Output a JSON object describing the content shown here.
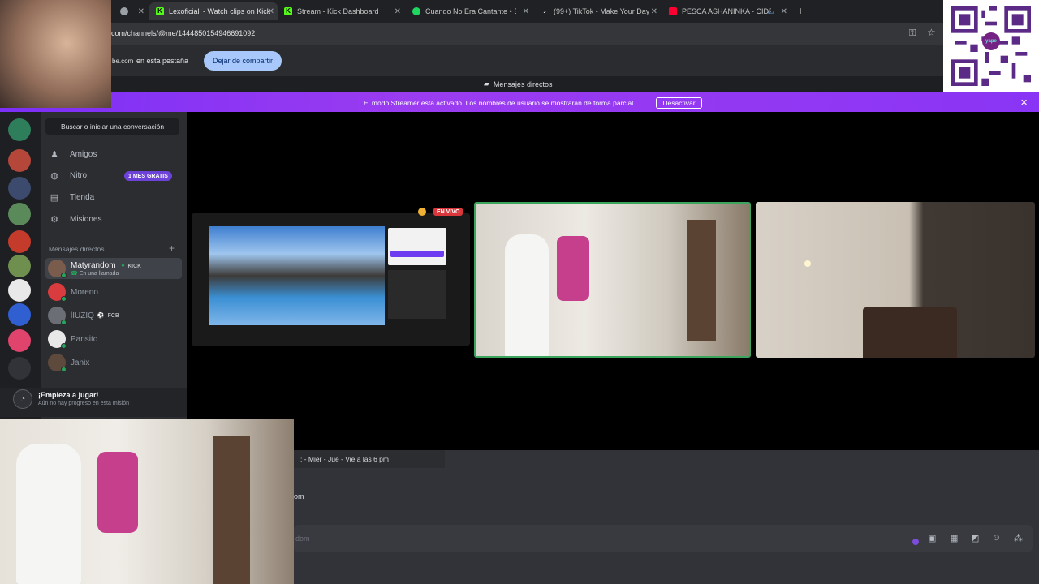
{
  "browser": {
    "tabs": [
      {
        "title": "",
        "favicon": "record-icon",
        "active": false
      },
      {
        "title": "Lexoficiall - Watch clips on Kick",
        "favicon": "kick-icon",
        "active": true
      },
      {
        "title": "Stream - Kick Dashboard",
        "favicon": "kick-icon",
        "active": false
      },
      {
        "title": "Cuando No Era Cantante • El B",
        "favicon": "spotify-icon",
        "active": false
      },
      {
        "title": "(99+) TikTok - Make Your Day",
        "favicon": "tiktok-icon",
        "active": false
      },
      {
        "title": "PESCA ASHANINKA - CIDF",
        "favicon": "youtube-icon",
        "active": false
      }
    ],
    "url": "com/channels/@me/1444850154946691092",
    "share_text_a": "be.com",
    "share_text_b": "en esta pestaña",
    "stop_share_label": "Dejar de compartir"
  },
  "discord": {
    "header_label": "Mensajes directos",
    "streamer_banner": "El modo Streamer está activado. Los nombres de usuario se mostrarán de forma parcial.",
    "deactivate_label": "Desactivar",
    "search_label": "Buscar o iniciar una conversación",
    "nav": [
      {
        "label": "Amigos",
        "icon": "friends-icon"
      },
      {
        "label": "Nitro",
        "icon": "nitro-icon"
      },
      {
        "label": "Tienda",
        "icon": "shop-icon"
      },
      {
        "label": "Misiones",
        "icon": "quests-icon"
      }
    ],
    "nitro_badge": "1 MES GRATIS",
    "dm_section_label": "Mensajes directos",
    "dms": [
      {
        "name": "Matyrandom",
        "tag": "KICK",
        "sub": "En una llamada",
        "active": true,
        "color": "#7a5c4d"
      },
      {
        "name": "Moreno",
        "tag": "",
        "sub": "",
        "active": false,
        "color": "#d83c3e"
      },
      {
        "name": "lIUZIQ",
        "tag": "FCB",
        "sub": "",
        "active": false,
        "color": "#6b6e75"
      },
      {
        "name": "Pansito",
        "tag": "",
        "sub": "",
        "active": false,
        "color": "#e8e8e8"
      },
      {
        "name": "Janix",
        "tag": "",
        "sub": "",
        "active": false,
        "color": "#5e4a3c"
      }
    ],
    "quest_title": "¡Empieza a jugar!",
    "quest_sub": "Aún no hay progreso en esta misión",
    "live_badge": "EN VIVO",
    "schedule_msg": ": - Mier - Jue - Vie a las 6 pm",
    "msg_fragment": "om",
    "composer_placeholder": "dom"
  },
  "colors": {
    "brand": "#5865f2",
    "streamer_banner": "#8a35f5",
    "live": "#da373c",
    "online": "#23a55a",
    "speaking_border": "#3ba55d"
  }
}
